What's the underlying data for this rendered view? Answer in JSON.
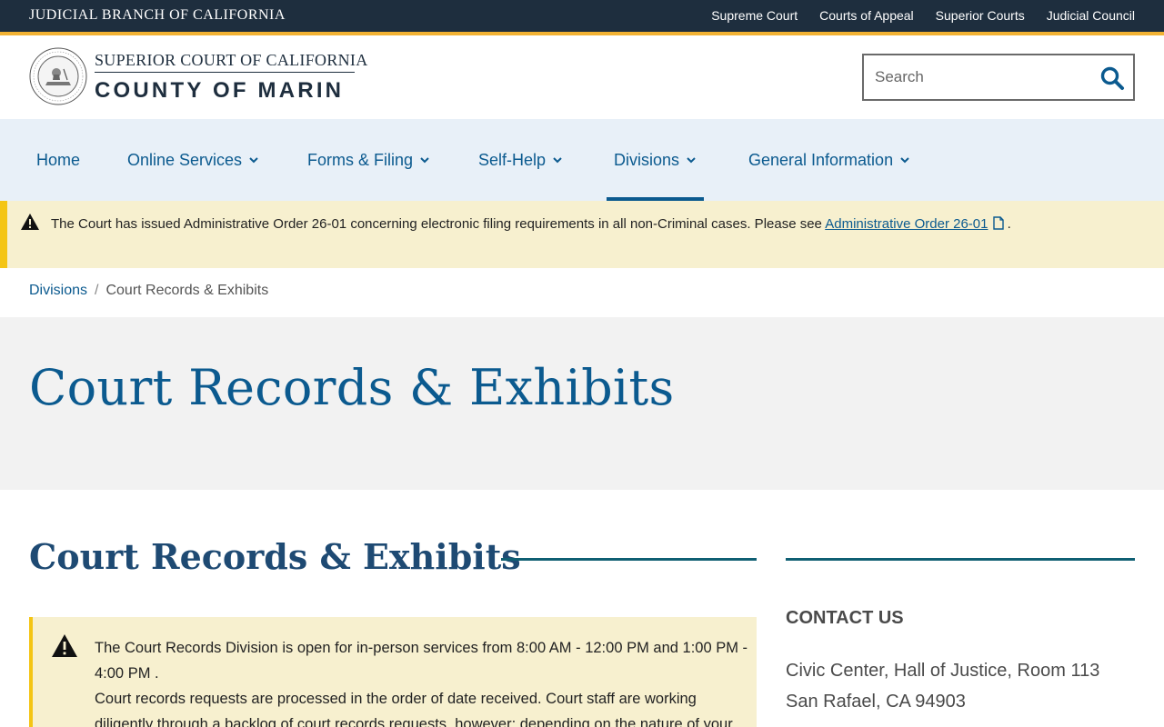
{
  "topbar": {
    "branch": "JUDICIAL BRANCH OF CALIFORNIA",
    "links": [
      "Supreme Court",
      "Courts of Appeal",
      "Superior Courts",
      "Judicial Council"
    ]
  },
  "brand": {
    "line1": "SUPERIOR COURT OF CALIFORNIA",
    "line2": "COUNTY OF MARIN",
    "seal_icon": "court-seal"
  },
  "search": {
    "placeholder": "Search",
    "icon": "search-icon"
  },
  "nav": {
    "items": [
      {
        "label": "Home",
        "has_dropdown": false
      },
      {
        "label": "Online Services",
        "has_dropdown": true
      },
      {
        "label": "Forms & Filing",
        "has_dropdown": true
      },
      {
        "label": "Self-Help",
        "has_dropdown": true
      },
      {
        "label": "Divisions",
        "has_dropdown": true,
        "active": true
      },
      {
        "label": "General Information",
        "has_dropdown": true
      }
    ]
  },
  "alert": {
    "text": "The Court has issued Administrative Order 26-01 concerning electronic filing requirements in all non-Criminal cases. Please see ",
    "link_text": "Administrative Order 26-01",
    "suffix": ".",
    "icon": "warning-icon"
  },
  "breadcrumb": {
    "parent": "Divisions",
    "separator": "/",
    "current": "Court Records & Exhibits"
  },
  "page_title": "Court Records & Exhibits",
  "section_title": "Court Records & Exhibits",
  "notice": {
    "line1": "The Court Records Division is open for in-person services from 8:00 AM - 12:00 PM and 1:00 PM - 4:00 PM .",
    "line2": "Court records requests are processed in the order of date received. Court staff are working diligently through a backlog of court records requests, however; depending on the nature of your"
  },
  "contact": {
    "title": "CONTACT US",
    "address1": "Civic Center, Hall of Justice, Room 113",
    "address2": "San Rafael, CA  94903"
  },
  "colors": {
    "topbar": "#1e2e3e",
    "accent": "#f2b233",
    "link": "#0b5a8f",
    "nav_bg": "#e8f0f8",
    "alert_bg": "#f7f0cf",
    "alert_border": "#f4c514",
    "rule": "#0f5f73"
  }
}
